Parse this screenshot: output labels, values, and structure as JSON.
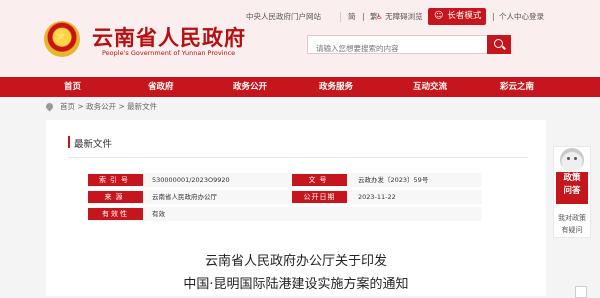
{
  "header": {
    "site_title": "云南省人民政府",
    "site_subtitle": "People's Government of Yunnan Province",
    "links": {
      "central_portal": "中央人民政府门户网站",
      "simplified": "简",
      "traditional": "繁",
      "accessibility": "无障碍浏览",
      "elder_mode": "长者模式",
      "personal_center": "个人中心登录"
    },
    "search_placeholder": "请输入您想要搜索的内容"
  },
  "nav": {
    "items": [
      "首页",
      "省政府",
      "政务公开",
      "政务服务",
      "互动交流",
      "彩云之南"
    ]
  },
  "breadcrumb": {
    "home": "首页",
    "sep1": ">",
    "section": "政务公开",
    "sep2": ">",
    "current": "最新文件"
  },
  "card": {
    "title": "最新文件"
  },
  "doc_info": {
    "index_label": "索引号",
    "index_value": "530000001/2023O9920",
    "doc_no_label": "文号",
    "doc_no_value": "云政办发〔2023〕59号",
    "source_label": "来源",
    "source_value": "云南省人民政府办公厅",
    "date_label": "公开日期",
    "date_value": "2023-11-22",
    "validity_label": "有效性",
    "validity_value": "有效"
  },
  "document": {
    "title_line1": "云南省人民政府办公厅关于印发",
    "title_line2": "中国·昆明国际陆港建设实施方案的通知"
  },
  "side_widget": {
    "policy_line1": "政策",
    "policy_line2": "问答",
    "ask_line1": "我对政策",
    "ask_line2": "有疑问"
  },
  "colors": {
    "brand_red": "#c4161c",
    "header_bg": "#fbeeee"
  }
}
